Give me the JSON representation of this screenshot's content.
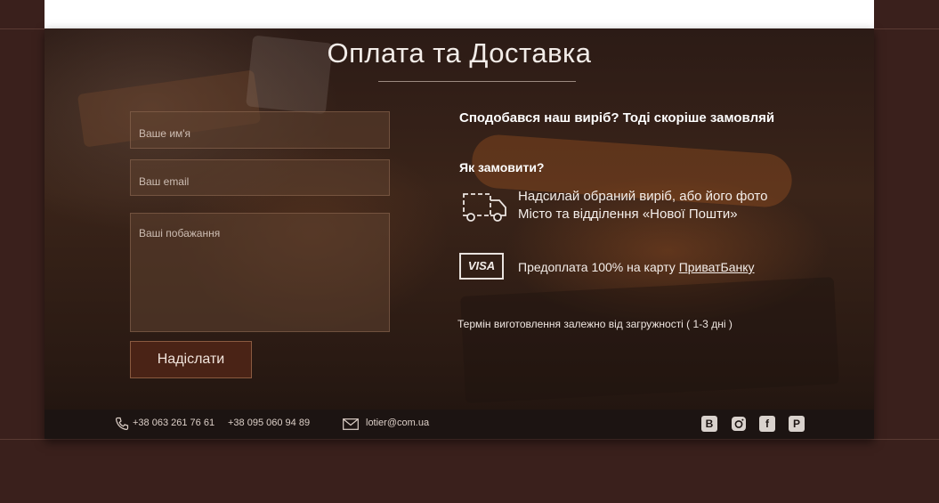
{
  "section": {
    "title": "Оплата та Доставка"
  },
  "form": {
    "name_placeholder": "Ваше им'я",
    "email_placeholder": "Ваш email",
    "wishes_placeholder": "Ваші побажання",
    "submit_label": "Надіслати"
  },
  "info": {
    "headline": "Сподобався наш виріб?  Тоді  скоріше замовляй",
    "how_to_order": "Як замовити?",
    "delivery_line1": "Надсилай обраний виріб, або його фото",
    "delivery_line2": "Місто та відділення «Нової Пошти»",
    "visa_label": "VISA",
    "prepay_text": "Предоплата 100% на карту ",
    "bank_name": "ПриватБанку",
    "production_term": "Термін виготовлення залежно від загружності ( 1-3 дні )"
  },
  "footer": {
    "phone1": "+38 063 261 76 61",
    "phone2": "+38 095 060 94 89",
    "email": "lotier@com.ua",
    "social_vk": "B",
    "social_fb": "f",
    "social_pinterest": "P"
  },
  "icons": {
    "truck": "truck-icon",
    "phone": "phone-icon",
    "mail": "mail-icon",
    "instagram": "instagram-icon"
  }
}
